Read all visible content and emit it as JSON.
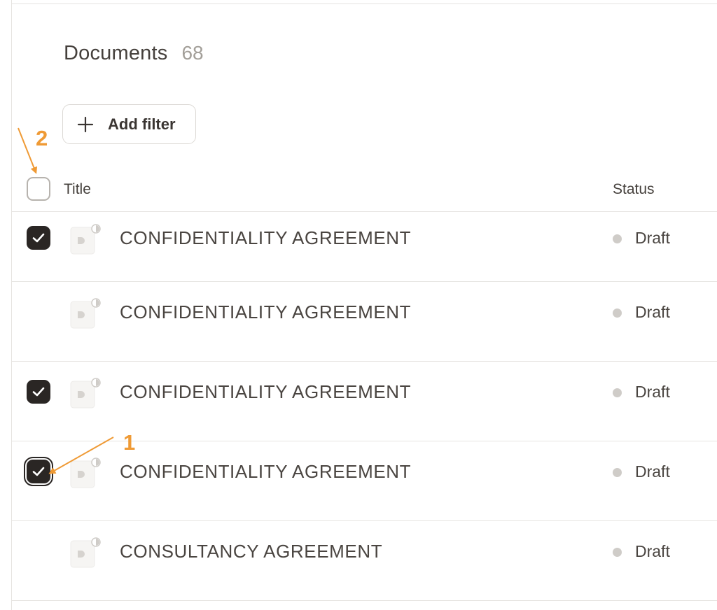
{
  "header": {
    "title": "Documents",
    "count": "68"
  },
  "toolbar": {
    "add_filter_label": "Add filter",
    "add_filter_icon": "plus-icon"
  },
  "table": {
    "columns": {
      "title": "Title",
      "status": "Status"
    },
    "select_all_checked": false,
    "rows": [
      {
        "title": "CONFIDENTIALITY AGREEMENT",
        "status": "Draft",
        "selected": true,
        "icon": "document-icon"
      },
      {
        "title": "CONFIDENTIALITY AGREEMENT",
        "status": "Draft",
        "selected": false,
        "icon": "document-icon"
      },
      {
        "title": "CONFIDENTIALITY AGREEMENT",
        "status": "Draft",
        "selected": true,
        "icon": "document-icon"
      },
      {
        "title": "CONFIDENTIALITY AGREEMENT",
        "status": "Draft",
        "selected": true,
        "icon": "document-icon"
      },
      {
        "title": "CONSULTANCY AGREEMENT",
        "status": "Draft",
        "selected": false,
        "icon": "document-icon"
      }
    ]
  },
  "annotations": {
    "marker_1": "1",
    "marker_2": "2",
    "color": "#ef9a35"
  },
  "colors": {
    "checkbox_checked": "#2a2624",
    "status_draft_dot": "#cfccc8",
    "count_text": "#a39f99"
  }
}
